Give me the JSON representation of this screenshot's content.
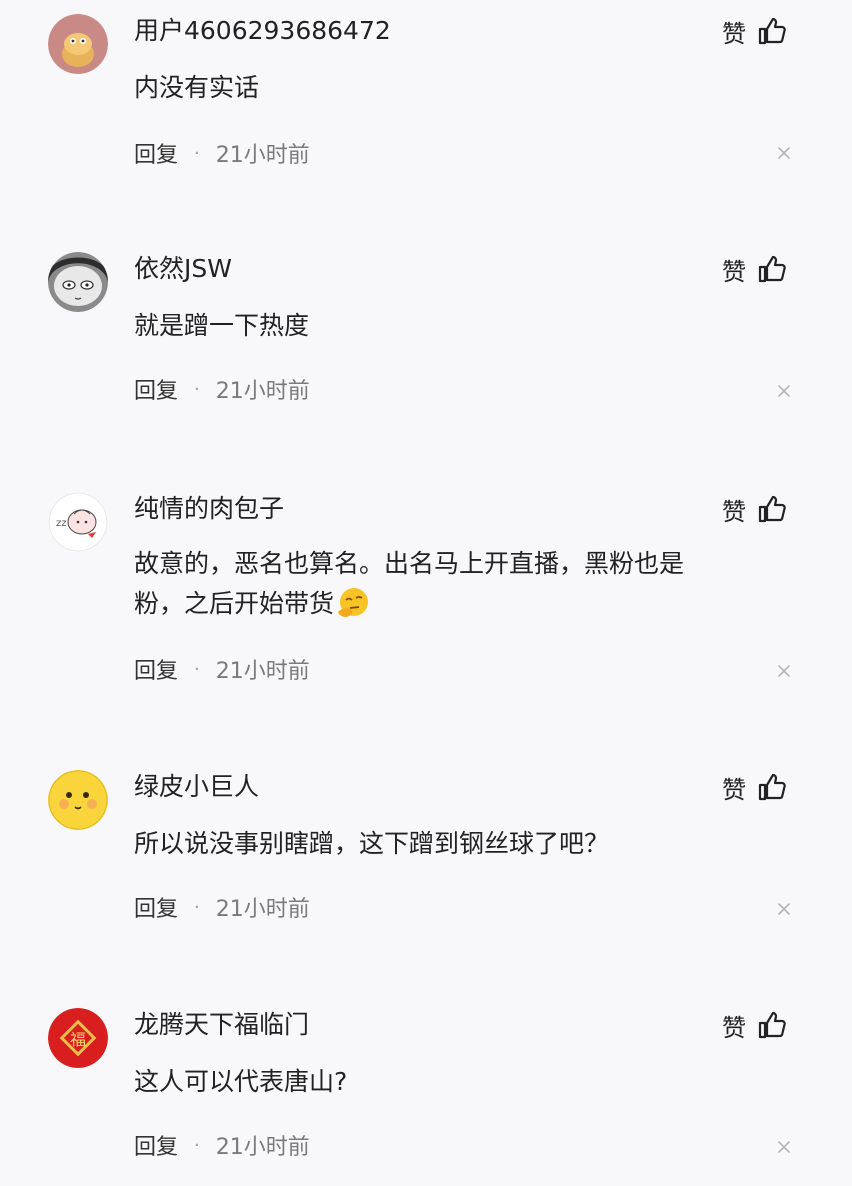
{
  "like_label": "赞",
  "reply_label": "回复",
  "separator": "·",
  "colors": {
    "background": "#f8f8fa",
    "text_primary": "#222222",
    "text_secondary": "#7a7a7a"
  },
  "comments": [
    {
      "username": "用户4606293686472",
      "content": "内没有实话",
      "time": "21小时前",
      "avatar_icon": "cartoon-bun-avatar"
    },
    {
      "username": "依然JSW",
      "content": "就是蹭一下热度",
      "time": "21小时前",
      "avatar_icon": "grey-face-avatar"
    },
    {
      "username": "纯情的肉包子",
      "content_line1": "故意的，恶名也算名。出名马上开直播，黑粉也是",
      "content_line2": "粉，之后开始带货",
      "content_emoji": "thinking-face-emoji",
      "time": "21小时前",
      "avatar_icon": "bun-character-avatar"
    },
    {
      "username": "绿皮小巨人",
      "content": "所以说没事别瞎蹭，这下蹭到钢丝球了吧？",
      "time": "21小时前",
      "avatar_icon": "yellow-smiley-avatar"
    },
    {
      "username": "龙腾天下福临门",
      "content": "这人可以代表唐山?",
      "time": "21小时前",
      "avatar_icon": "red-fu-avatar"
    }
  ]
}
